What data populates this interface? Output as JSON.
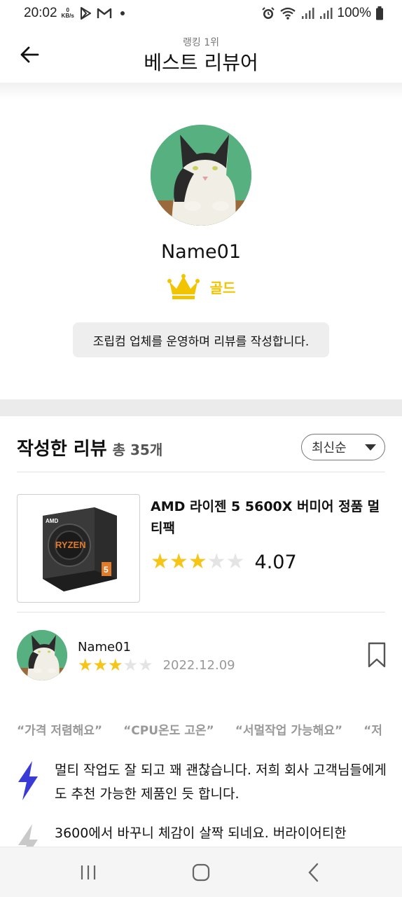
{
  "status_bar": {
    "time": "20:02",
    "speed_value": "0",
    "speed_unit": "KB/s",
    "battery": "100%"
  },
  "header": {
    "subtitle": "랭킹 1위",
    "title": "베스트 리뷰어"
  },
  "profile": {
    "name": "Name01",
    "rank": "골드",
    "bio": "조립컴 업체를 운영하며 리뷰를 작성합니다.",
    "rank_color": "#f2c400"
  },
  "reviews_section": {
    "title": "작성한 리뷰",
    "count_label": "총 35개",
    "sort": {
      "selected": "최신순"
    }
  },
  "product": {
    "name": "AMD 라이젠 5 5600X 버미어 정품 멀티팩",
    "rating_value": "4.07",
    "stars_filled": 3,
    "stars_total": 5,
    "thumb_box_brand": "AMD",
    "thumb_box_label": "RYZEN",
    "thumb_box_number": "5"
  },
  "review": {
    "reviewer_name": "Name01",
    "stars_filled": 3,
    "stars_total": 5,
    "date": "2022.12.09",
    "keywords": [
      "“가격 저렴해요”",
      "“CPU온도 고온”",
      "“서멀작업 가능해요”",
      "“저"
    ],
    "items": [
      {
        "icon": "lightning-icon",
        "text": "멀티 작업도 잘 되고 꽤 괜찮습니다. 저희 회사 고객님들에게도 추천 가능한 제품인 듯 합니다."
      },
      {
        "icon": "lightning-gray-icon",
        "text": "3600에서 바꾸니 체감이 살짝 되네요. 버라이어티한"
      }
    ]
  },
  "colors": {
    "accent_star": "#f5c518",
    "lightning_blue": "#3a3ad6",
    "avatar_bg": "#57b07f",
    "section_gap": "#ebebeb"
  }
}
